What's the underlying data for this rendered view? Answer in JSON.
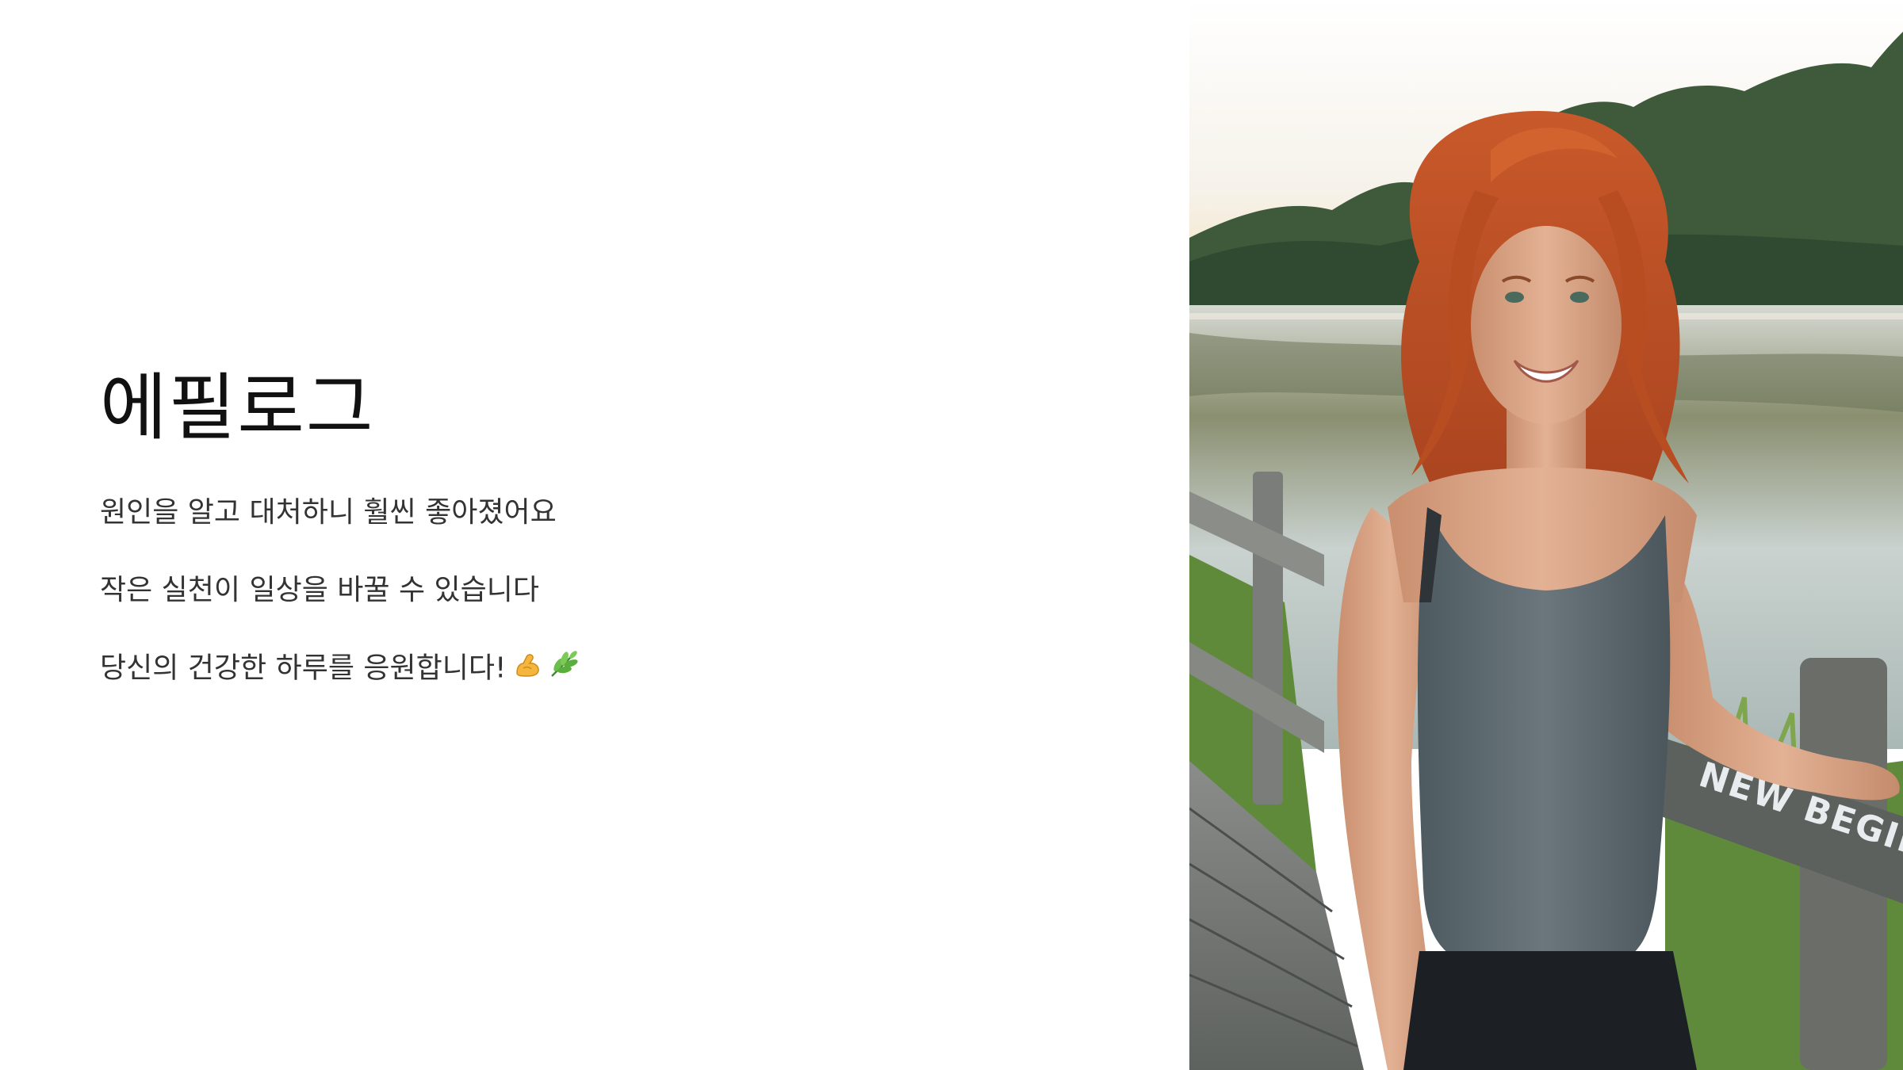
{
  "title": "에필로그",
  "lines": [
    "원인을 알고 대처하니 훨씬 좋아졌어요",
    "작은 실천이 일상을 바꿀 수 있습니다",
    "당신의 건강한 하루를 응원합니다!"
  ],
  "line_icons": [
    "flexed-biceps-icon",
    "herb-leaf-icon"
  ],
  "photo": {
    "sign_text": "NEW BEGINNING"
  },
  "colors": {
    "background": "#ffffff",
    "title": "#111111",
    "body_text": "#333333"
  }
}
